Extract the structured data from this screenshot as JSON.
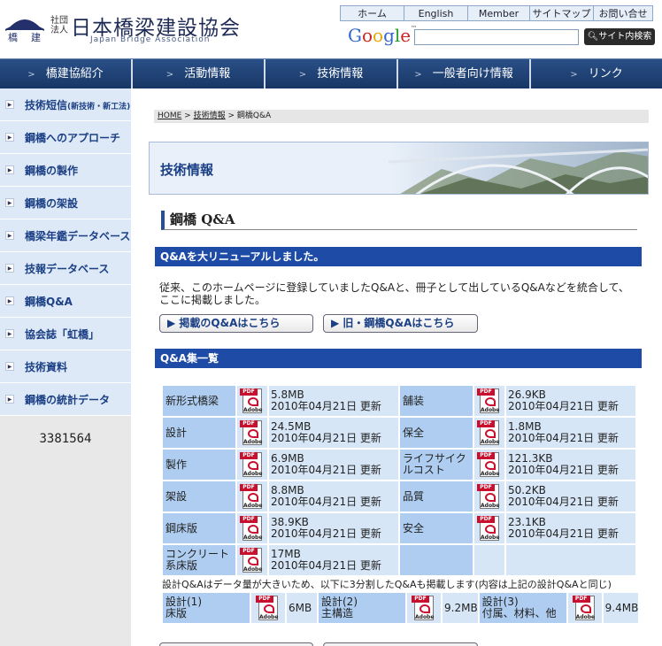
{
  "header": {
    "logo_small": "社団法人",
    "logo_title": "日本橋梁建設協会",
    "logo_en": "Japan Bridge Association",
    "logo_mark_chars": [
      "橋",
      "建"
    ],
    "top_links": [
      "ホーム",
      "English",
      "Member",
      "サイトマップ",
      "お問い合せ"
    ],
    "search_brand": "Google",
    "search_button": "サイト内検索"
  },
  "mainnav": [
    "橋建協紹介",
    "活動情報",
    "技術情報",
    "一般者向け情報",
    "リンク"
  ],
  "sidebar": {
    "items": [
      {
        "label": "技術短信",
        "sub": "(新技術・新工法)"
      },
      {
        "label": "鋼橋へのアプローチ",
        "sub": ""
      },
      {
        "label": "鋼橋の製作",
        "sub": ""
      },
      {
        "label": "鋼橋の架設",
        "sub": ""
      },
      {
        "label": "橋梁年鑑データベース",
        "sub": ""
      },
      {
        "label": "技報データベース",
        "sub": ""
      },
      {
        "label": "鋼橋Q&A",
        "sub": ""
      },
      {
        "label": "協会誌「虹橋」",
        "sub": ""
      },
      {
        "label": "技術資料",
        "sub": ""
      },
      {
        "label": "鋼橋の統計データ",
        "sub": ""
      }
    ],
    "counter": "3381564"
  },
  "breadcrumb": {
    "home": "HOME",
    "sep1": " > ",
    "tech": "技術情報",
    "sep2": " > ",
    "current": "鋼橋Q&A"
  },
  "banner_title": "技術情報",
  "page_title": "鋼橋 Q&A",
  "renewal_bar": "Q&Aを大リニューアルしました。",
  "intro": "従来、このホームページに登録していましたQ&Aと、冊子として出しているQ&Aなどを統合して、ここに掲載しました。",
  "buttons": {
    "current": "▶ 掲載のQ&Aはこちら",
    "old": "▶ 旧・鋼橋Q&Aはこちら"
  },
  "list_bar": "Q&A集一覧",
  "pdf_icon": {
    "tag": "PDF",
    "brand": "Adobe"
  },
  "qa_rows": [
    [
      {
        "name": "新形式橋梁",
        "size": "5.8MB",
        "date": "2010年04月21日 更新"
      },
      {
        "name": "舗装",
        "size": "26.9KB",
        "date": "2010年04月21日 更新"
      }
    ],
    [
      {
        "name": "設計",
        "size": "24.5MB",
        "date": "2010年04月21日 更新"
      },
      {
        "name": "保全",
        "size": "1.8MB",
        "date": "2010年04月21日 更新"
      }
    ],
    [
      {
        "name": "製作",
        "size": "6.9MB",
        "date": "2010年04月21日 更新"
      },
      {
        "name": "ライフサイクルコスト",
        "size": "121.3KB",
        "date": "2010年04月21日 更新"
      }
    ],
    [
      {
        "name": "架設",
        "size": "8.8MB",
        "date": "2010年04月21日 更新"
      },
      {
        "name": "品質",
        "size": "50.2KB",
        "date": "2010年04月21日 更新"
      }
    ],
    [
      {
        "name": "鋼床版",
        "size": "38.9KB",
        "date": "2010年04月21日 更新"
      },
      {
        "name": "安全",
        "size": "23.1KB",
        "date": "2010年04月21日 更新"
      }
    ],
    [
      {
        "name": "コンクリート系床版",
        "size": "17MB",
        "date": "2010年04月21日 更新"
      },
      null
    ]
  ],
  "note": "設計Q&Aはデータ量が大きいため、以下に3分割したQ&Aも掲載します(内容は上記の設計Q&Aと同じ)",
  "sub_items": [
    {
      "name": "設計(1)\n床版",
      "size": "6MB"
    },
    {
      "name": "設計(2)\n主構造",
      "size": "9.2MB"
    },
    {
      "name": "設計(3)\n付属、材料、他",
      "size": "9.4MB"
    }
  ]
}
